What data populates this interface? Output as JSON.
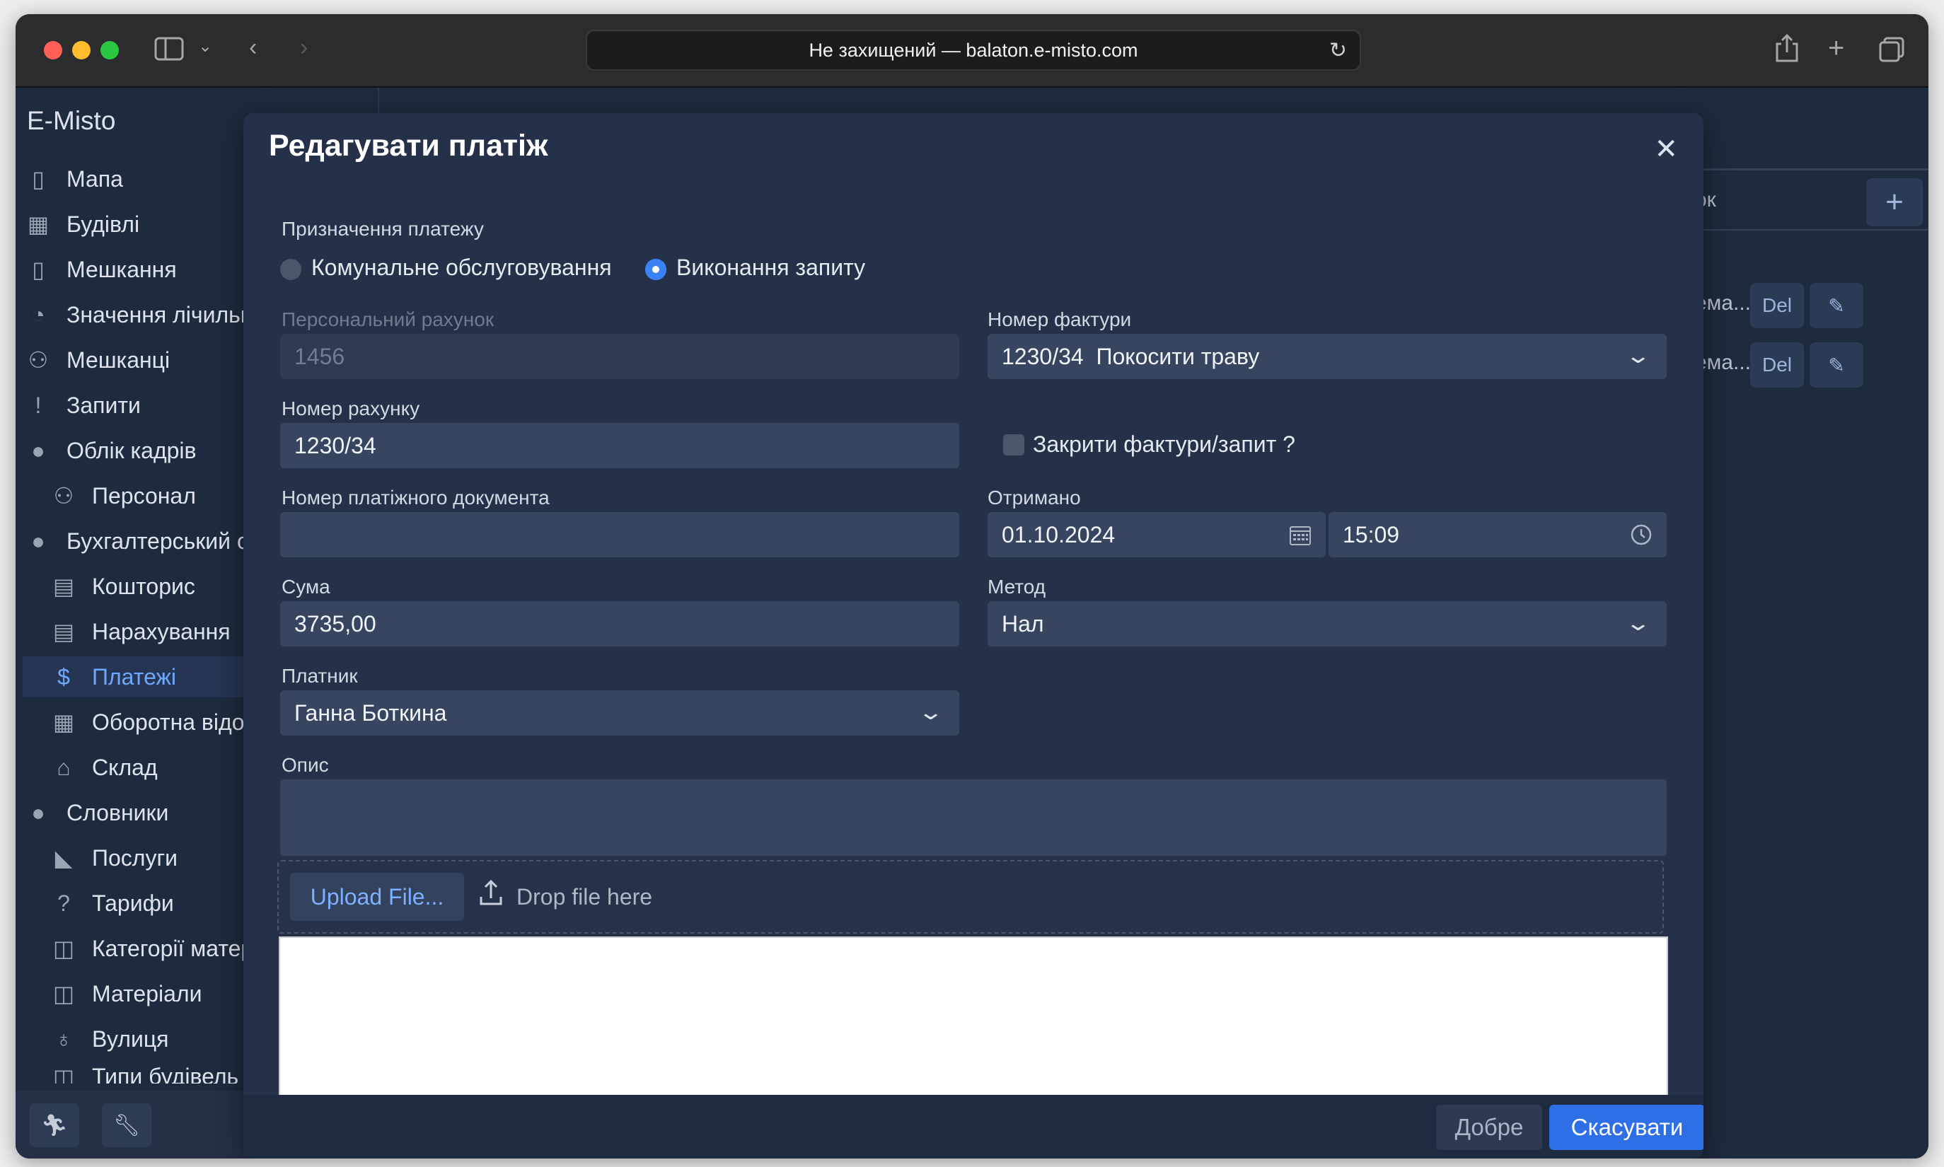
{
  "browser": {
    "url_text": "Не захищений — balaton.e-misto.com",
    "icons": [
      "sidebar-toggle-icon",
      "chevron-down-icon",
      "back-icon",
      "forward-icon",
      "reload-icon",
      "share-icon",
      "new-tab-icon",
      "tab-overview-icon"
    ]
  },
  "sidebar": {
    "brand": "E-Misto",
    "items": [
      {
        "label": "Мапа",
        "icon": "map-icon"
      },
      {
        "label": "Будівлі",
        "icon": "building-icon"
      },
      {
        "label": "Мешкання",
        "icon": "door-icon"
      },
      {
        "label": "Значення лічильників",
        "icon": "gauge-icon"
      },
      {
        "label": "Мешканці",
        "icon": "people-icon"
      },
      {
        "label": "Запити",
        "icon": "exclamation-icon"
      },
      {
        "label": "Облік кадрів",
        "icon": "globe-icon"
      },
      {
        "label": "Персонал",
        "icon": "staff-icon"
      },
      {
        "label": "Бухгалтерський облік",
        "icon": "globe-icon"
      },
      {
        "label": "Кошторис",
        "icon": "estimate-icon"
      },
      {
        "label": "Нарахування",
        "icon": "invoice-icon"
      },
      {
        "label": "Платежі",
        "icon": "dollar-icon"
      },
      {
        "label": "Оборотна відомість",
        "icon": "table-icon"
      },
      {
        "label": "Склад",
        "icon": "warehouse-icon"
      },
      {
        "label": "Словники",
        "icon": "globe-icon"
      },
      {
        "label": "Послуги",
        "icon": "service-icon"
      },
      {
        "label": "Тарифи",
        "icon": "question-icon"
      },
      {
        "label": "Категорії матеріалів",
        "icon": "square-icon"
      },
      {
        "label": "Матеріали",
        "icon": "square-icon"
      },
      {
        "label": "Вулиця",
        "icon": "pin-icon"
      },
      {
        "label": "Типи будівель",
        "icon": "square-icon"
      }
    ],
    "active_index": 11
  },
  "background": {
    "search_fragment": "ок",
    "row1_text": "ема...",
    "row2_text": "ема...",
    "del_label": "Del"
  },
  "modal": {
    "title": "Редагувати платіж",
    "purpose_label": "Призначення платежу",
    "purpose_options": [
      "Комунальне обслуговування",
      "Виконання запиту"
    ],
    "purpose_selected": "Виконання запиту",
    "personal_account_label": "Персональний рахунок",
    "personal_account_value": "1456",
    "invoice_number_label": "Номер фактури",
    "invoice_number_value": "1230/34  Покосити траву",
    "account_number_label": "Номер рахунку",
    "account_number_value": "1230/34",
    "close_invoice_label": "Закрити фактури/запит ?",
    "close_invoice_checked": false,
    "payment_doc_label": "Номер платіжного документа",
    "payment_doc_value": "",
    "received_label": "Отримано",
    "received_date": "01.10.2024",
    "received_time": "15:09",
    "amount_label": "Сума",
    "amount_value": "3735,00",
    "method_label": "Метод",
    "method_value": "Нал",
    "payer_label": "Платник",
    "payer_value": "Ганна Боткина",
    "description_label": "Опис",
    "description_value": "",
    "upload_button": "Upload File...",
    "drop_text": "Drop file here",
    "ok_button": "Добре",
    "cancel_button": "Скасувати"
  },
  "colors": {
    "accent": "#2f6fe6",
    "link": "#6ea8fe",
    "panel": "#253148",
    "field": "#374560"
  }
}
